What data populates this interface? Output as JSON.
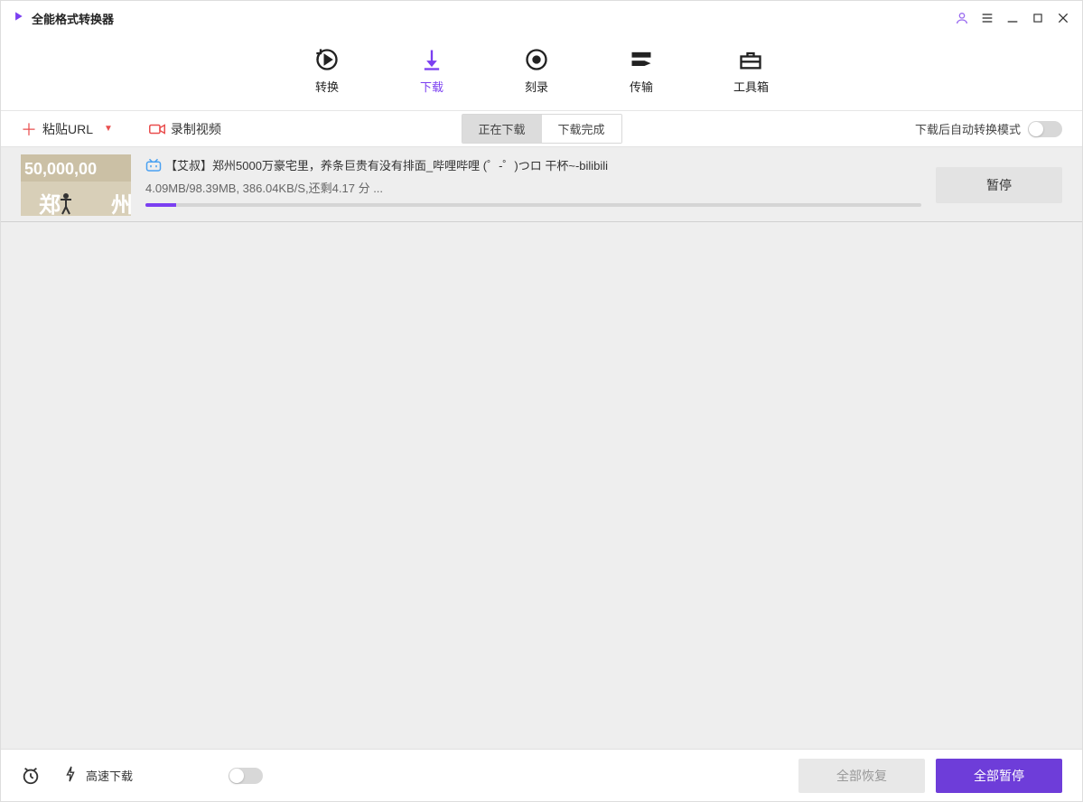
{
  "app": {
    "title": "全能格式转换器",
    "colors": {
      "accent": "#7b3ff1",
      "danger": "#e94f4f"
    }
  },
  "nav": [
    {
      "key": "convert",
      "label": "转换",
      "active": false
    },
    {
      "key": "download",
      "label": "下载",
      "active": true
    },
    {
      "key": "burn",
      "label": "刻录",
      "active": false
    },
    {
      "key": "transfer",
      "label": "传输",
      "active": false
    },
    {
      "key": "toolbox",
      "label": "工具箱",
      "active": false
    }
  ],
  "toolbar": {
    "paste_url": "粘贴URL",
    "record_video": "录制视频",
    "tabs": {
      "downloading": "正在下载",
      "finished": "下载完成",
      "active": "downloading"
    },
    "auto_convert_label": "下载后自动转换模式",
    "auto_convert_on": false
  },
  "tasks": [
    {
      "source": "bilibili",
      "title": "【艾叔】郑州5000万豪宅里，养条巨贵有没有排面_哔哩哔哩 (゜-゜)つロ 干杯~-bilibili",
      "downloaded_mb": "4.09MB",
      "total_mb": "98.39MB",
      "speed": "386.04KB/S",
      "eta": "还剩4.17 分 ...",
      "progress_text": "4.09MB/98.39MB, 386.04KB/S,还剩4.17 分 ...",
      "progress_pct": 4,
      "action": "暂停",
      "thumb_text": "50,000,00"
    }
  ],
  "bottom": {
    "fast_download": "高速下载",
    "fast_download_on": false,
    "resume_all": "全部恢复",
    "pause_all": "全部暂停"
  }
}
